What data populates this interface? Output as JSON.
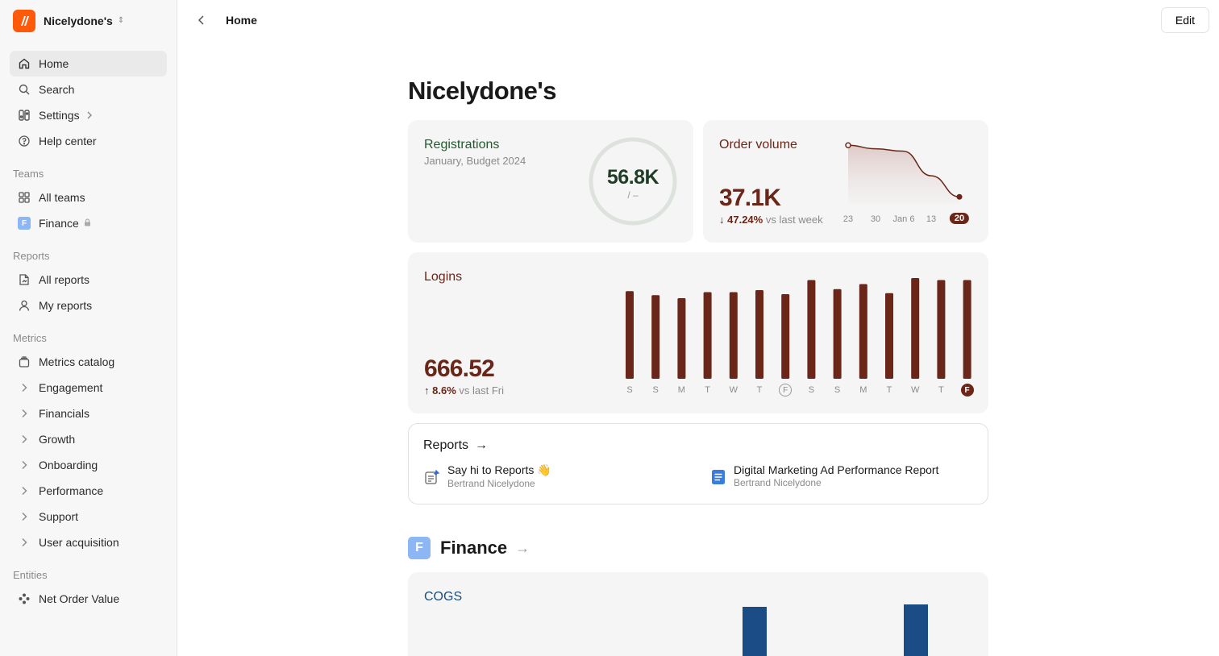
{
  "workspace": {
    "name": "Nicelydone's"
  },
  "nav": {
    "home": "Home",
    "search": "Search",
    "settings": "Settings",
    "help": "Help center"
  },
  "sections": {
    "teams": "Teams",
    "reports": "Reports",
    "metrics": "Metrics",
    "entities": "Entities"
  },
  "teams": {
    "all": "All teams",
    "finance": "Finance",
    "finance_badge": "F"
  },
  "reports_nav": {
    "all": "All reports",
    "mine": "My reports"
  },
  "metrics_nav": {
    "catalog": "Metrics catalog",
    "groups": [
      "Engagement",
      "Financials",
      "Growth",
      "Onboarding",
      "Performance",
      "Support",
      "User acquisition"
    ]
  },
  "entities_nav": {
    "item": "Net Order Value"
  },
  "topbar": {
    "crumb": "Home",
    "edit": "Edit"
  },
  "page": {
    "title": "Nicelydone's"
  },
  "registrations": {
    "title": "Registrations",
    "subtitle": "January, Budget 2024",
    "value": "56.8K",
    "target": "/ –"
  },
  "order_volume": {
    "title": "Order volume",
    "value": "37.1K",
    "delta_pct": "47.24%",
    "delta_text": "vs last week",
    "ticks": [
      "23",
      "30",
      "Jan 6",
      "13",
      "20"
    ],
    "selected_tick": "20"
  },
  "logins": {
    "title": "Logins",
    "value": "666.52",
    "delta_pct": "8.6%",
    "delta_text": "vs last Fri",
    "days": [
      "S",
      "S",
      "M",
      "T",
      "W",
      "T",
      "F",
      "S",
      "S",
      "M",
      "T",
      "W",
      "T",
      "F"
    ]
  },
  "reports": {
    "title": "Reports",
    "items": [
      {
        "title": "Say hi to Reports 👋",
        "author": "Bertrand Nicelydone"
      },
      {
        "title": "Digital Marketing Ad Performance Report",
        "author": "Bertrand Nicelydone"
      }
    ]
  },
  "finance": {
    "badge": "F",
    "title": "Finance"
  },
  "cogs": {
    "title": "COGS"
  },
  "colors": {
    "brand_orange": "#ff5a0a",
    "green": "#1f5a2e",
    "brown": "#6a2618",
    "blue": "#1a4d80",
    "finance_badge": "#8db6f5"
  },
  "chart_data": [
    {
      "type": "line",
      "title": "Order volume",
      "x": [
        "23",
        "30",
        "Jan 6",
        "13",
        "20"
      ],
      "series": [
        {
          "values": [
            41.5,
            41.2,
            41.0,
            38.9,
            37.1
          ]
        }
      ]
    },
    {
      "type": "bar",
      "title": "Logins",
      "categories": [
        "S",
        "S",
        "M",
        "T",
        "W",
        "T",
        "F",
        "S",
        "S",
        "M",
        "T",
        "W",
        "T",
        "F"
      ],
      "values": [
        0.87,
        0.83,
        0.8,
        0.86,
        0.86,
        0.88,
        0.84,
        0.98,
        0.89,
        0.94,
        0.85,
        1.0,
        0.98,
        0.98
      ]
    },
    {
      "type": "bar",
      "title": "COGS",
      "categories": [],
      "values": []
    }
  ]
}
